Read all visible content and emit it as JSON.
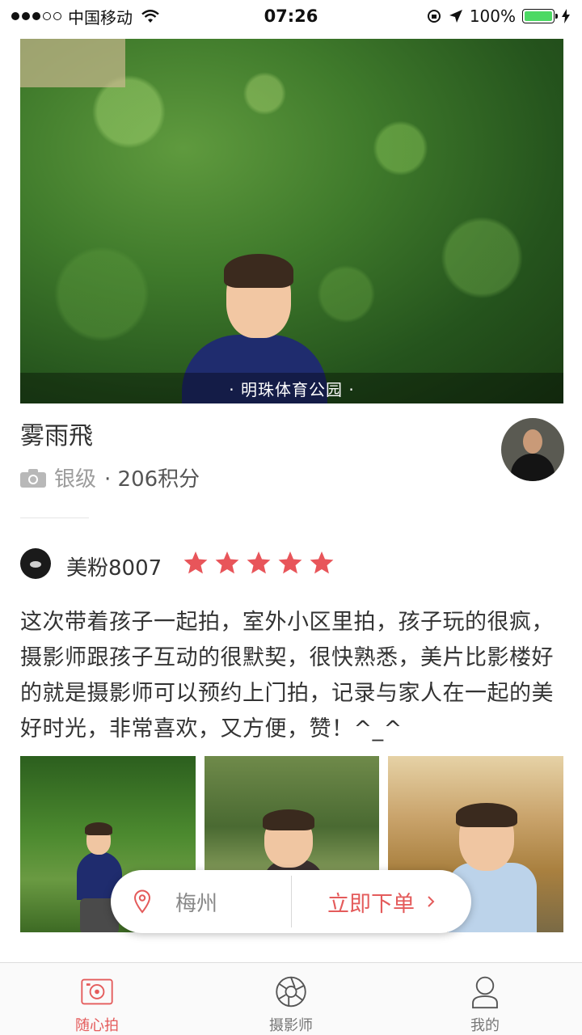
{
  "status_bar": {
    "carrier": "中国移动",
    "time": "07:26",
    "battery": "100%",
    "battery_level": 1.0,
    "signal_bars_filled": 3,
    "signal_bars_total": 5
  },
  "hero": {
    "location": "· 明珠体育公园 ·"
  },
  "photographer": {
    "name": "雾雨飛",
    "level": "银级",
    "points": "· 206积分"
  },
  "review": {
    "reviewer": "美粉8007",
    "rating": 5,
    "text": "这次带着孩子一起拍，室外小区里拍，孩子玩的很疯，摄影师跟孩子互动的很默契，很快熟悉，美片比影楼好的就是摄影师可以预约上门拍，记录与家人在一起的美好时光，非常喜欢，又方便，赞！^_^"
  },
  "order_bar": {
    "city": "梅州",
    "order_label": "立即下单"
  },
  "tabs": [
    {
      "label": "随心拍",
      "icon": "camera-icon",
      "active": true
    },
    {
      "label": "摄影师",
      "icon": "aperture-icon",
      "active": false
    },
    {
      "label": "我的",
      "icon": "person-icon",
      "active": false
    }
  ],
  "colors": {
    "accent": "#e45b5b",
    "star": "#e8555a"
  }
}
